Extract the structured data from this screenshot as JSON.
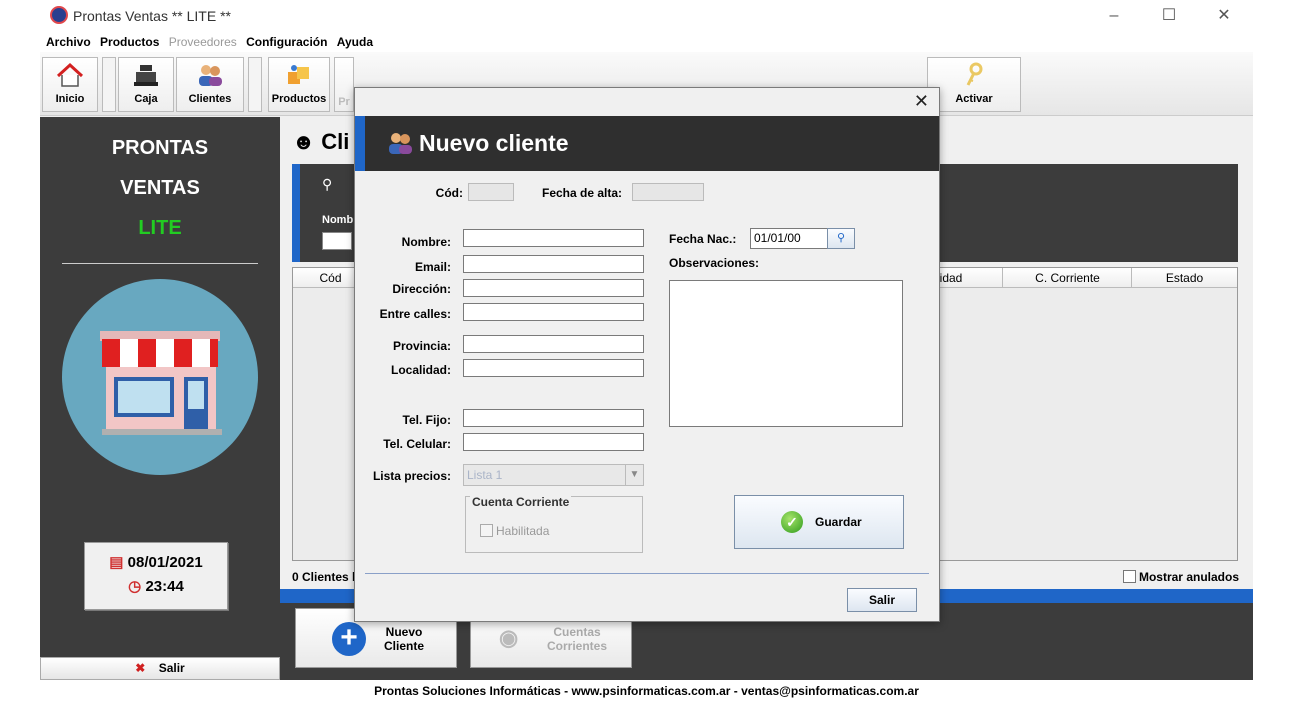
{
  "window": {
    "title": "Prontas Ventas  ** LITE **"
  },
  "menu": [
    {
      "label": "Archivo",
      "enabled": true
    },
    {
      "label": "Productos",
      "enabled": true
    },
    {
      "label": "Proveedores",
      "enabled": false
    },
    {
      "label": "Configuración",
      "enabled": true
    },
    {
      "label": "Ayuda",
      "enabled": true
    }
  ],
  "toolbar": {
    "inicio": "Inicio",
    "caja": "Caja",
    "clientes": "Clientes",
    "productos": "Productos",
    "pr_partial": "Pr",
    "activar": "Activar"
  },
  "sidebar": {
    "brand_line1": "PRONTAS",
    "brand_line2": "VENTAS",
    "brand_line3": "LITE",
    "date": "08/01/2021",
    "time": "23:44",
    "salir": "Salir"
  },
  "main": {
    "title_partial": "Cli",
    "nombre_partial": "Nomb",
    "table_headers": [
      "Cód",
      "lidad",
      "C. Corriente",
      "Estado"
    ],
    "count": "0 Clientes li",
    "mostrar_anulados": "Mostrar anulados",
    "nuevo_cliente_l1": "Nuevo",
    "nuevo_cliente_l2": "Cliente",
    "cuentas_l1": "Cuentas",
    "cuentas_l2": "Corrientes"
  },
  "dialog": {
    "title": "Nuevo cliente",
    "labels": {
      "cod": "Cód:",
      "fecha_alta": "Fecha de alta:",
      "nombre": "Nombre:",
      "email": "Email:",
      "direccion": "Dirección:",
      "entre_calles": "Entre calles:",
      "provincia": "Provincia:",
      "localidad": "Localidad:",
      "tel_fijo": "Tel. Fijo:",
      "tel_celular": "Tel. Celular:",
      "lista_precios": "Lista precios:",
      "fecha_nac": "Fecha Nac.:",
      "observaciones": "Observaciones:"
    },
    "values": {
      "cod": "",
      "fecha_alta": "",
      "nombre": "",
      "email": "",
      "direccion": "",
      "entre_calles": "",
      "provincia": "",
      "localidad": "",
      "tel_fijo": "",
      "tel_celular": "",
      "fecha_nac": "01/01/00",
      "lista_precios": "Lista 1"
    },
    "cuenta_corriente_group": "Cuenta Corriente",
    "habilitada": "Habilitada",
    "guardar": "Guardar",
    "salir": "Salir"
  },
  "footer": "Prontas Soluciones Informáticas - www.psinformaticas.com.ar - ventas@psinformaticas.com.ar",
  "colors": {
    "accent": "#1f66c8",
    "dark": "#3c3c3c",
    "lite": "#22cc22"
  }
}
